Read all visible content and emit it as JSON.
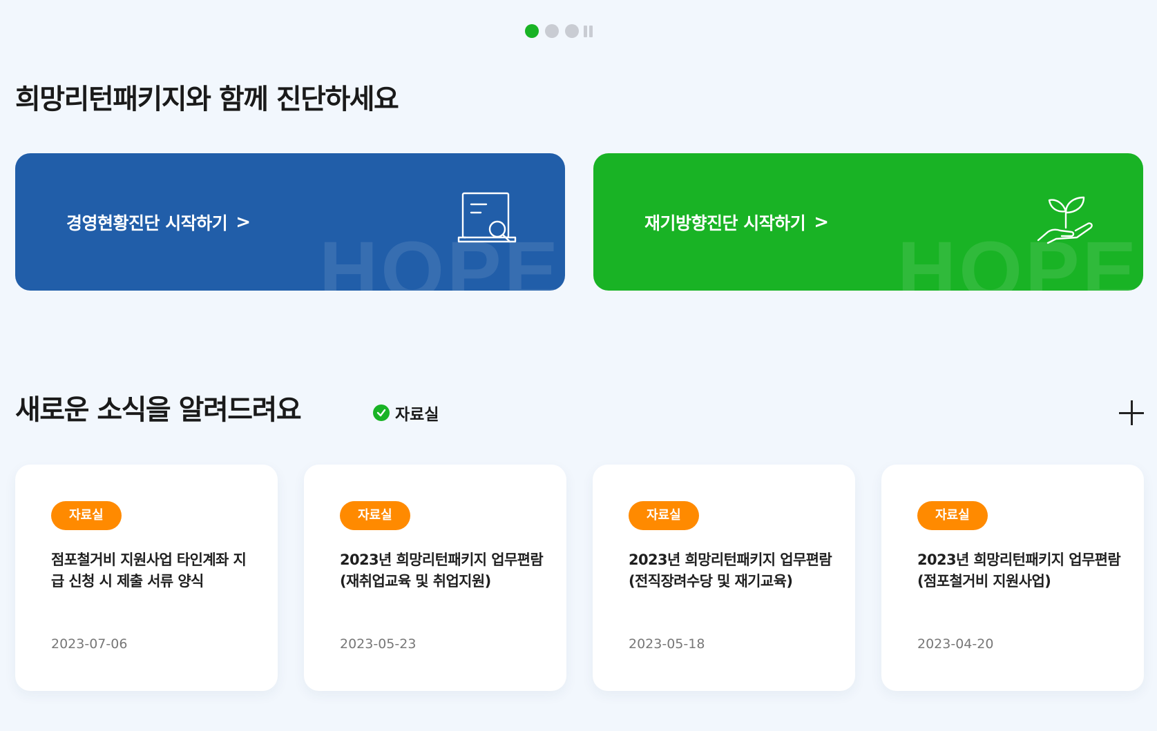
{
  "title": "희망리턴패키지와 함께 진단하세요",
  "diagnosis": [
    {
      "label": "경영현황진단 시작하기",
      "watermark": "HOPE",
      "icon": "document-search-icon",
      "color": "#215ea9"
    },
    {
      "label": "재기방향진단 시작하기",
      "watermark": "HOPE",
      "icon": "plant-hand-icon",
      "color": "#19b325"
    }
  ],
  "news": {
    "title": "새로운 소식을 알려드려요",
    "filter": "자료실",
    "more_icon": "plus-icon",
    "cards": [
      {
        "badge": "자료실",
        "title": "점포철거비 지원사업 타인계좌 지급 신청 시 제출 서류 양식",
        "date": "2023-07-06"
      },
      {
        "badge": "자료실",
        "title": "2023년 희망리턴패키지 업무편람(재취업교육 및 취업지원)",
        "date": "2023-05-23"
      },
      {
        "badge": "자료실",
        "title": "2023년 희망리턴패키지 업무편람(전직장려수당 및 재기교육)",
        "date": "2023-05-18"
      },
      {
        "badge": "자료실",
        "title": "2023년 희망리턴패키지 업무편람(점포철거비 지원사업)",
        "date": "2023-04-20"
      }
    ]
  },
  "colors": {
    "accent_green": "#19b325",
    "accent_blue": "#215ea9",
    "badge_orange": "#ff8a00",
    "background": "#f2f7fd"
  }
}
